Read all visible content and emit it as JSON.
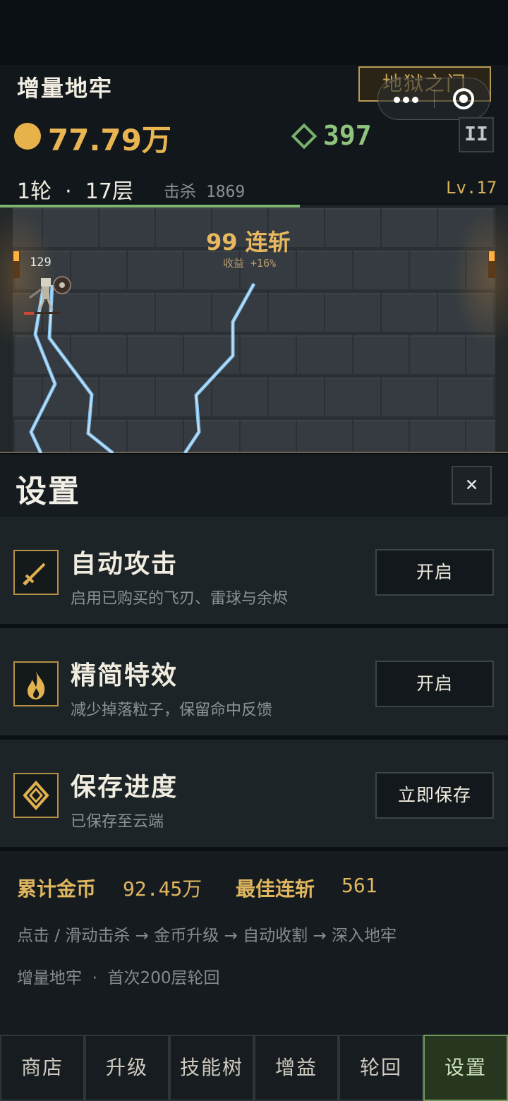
{
  "header": {
    "title": "增量地牢",
    "hell_gate_label": "地狱之门",
    "gold": "77.79万",
    "gems": "397",
    "pause_label": "II",
    "round_floor": "1轮  ·  17层",
    "kills": "击杀 1869",
    "level": "Lv.17",
    "floor_progress": 0.59
  },
  "battle": {
    "combo": "99 连斩",
    "combo_bonus": "收益 +16%",
    "enemy_hp": "129"
  },
  "settings": {
    "title": "设置",
    "close_label": "×",
    "items": [
      {
        "title": "自动攻击",
        "desc": "启用已购买的飞刃、雷球与余烬",
        "button": "开启",
        "icon": "sword-icon"
      },
      {
        "title": "精简特效",
        "desc": "减少掉落粒子，保留命中反馈",
        "button": "开启",
        "icon": "flame-icon"
      },
      {
        "title": "保存进度",
        "desc": "已保存至云端",
        "button": "立即保存",
        "icon": "diamond-icon"
      }
    ]
  },
  "stats": {
    "total_gold_label": "累计金币",
    "total_gold_value": "92.45万",
    "best_combo_label": "最佳连斩",
    "best_combo_value": "561",
    "flow": "点击 / 滑动击杀 → 金币升级 → 自动收割 → 深入地牢",
    "footer": "增量地牢  ·  首次200层轮回"
  },
  "tabs": [
    {
      "label": "商店",
      "active": false
    },
    {
      "label": "升级",
      "active": false
    },
    {
      "label": "技能树",
      "active": false
    },
    {
      "label": "增益",
      "active": false
    },
    {
      "label": "轮回",
      "active": false
    },
    {
      "label": "设置",
      "active": true
    }
  ],
  "colors": {
    "gold": "#e9b552",
    "gem": "#8fc47e",
    "accent_border": "#b58f45",
    "active_tab": "#27361f",
    "lightning": "#8fd0ff"
  }
}
